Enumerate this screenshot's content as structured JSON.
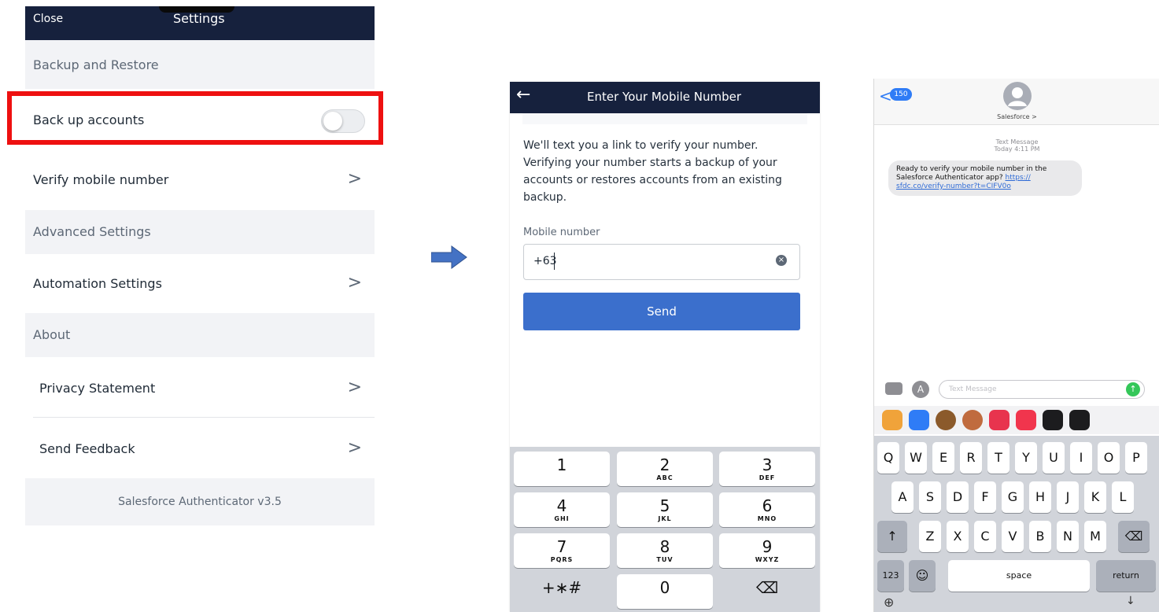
{
  "settings_panel": {
    "close": "Close",
    "title": "Settings",
    "section_backup": "Backup and Restore",
    "backup_label": "Back up accounts",
    "backup_enabled": false,
    "verify_label": "Verify mobile number",
    "section_advanced": "Advanced Settings",
    "automation_label": "Automation Settings",
    "section_about": "About",
    "privacy_label": "Privacy Statement",
    "feedback_label": "Send Feedback",
    "version": "Salesforce Authenticator v3.5",
    "chevron": ">",
    "highlight_color": "#ee1010"
  },
  "mobile_panel": {
    "back_icon": "←",
    "title": "Enter Your Mobile Number",
    "body": "We'll text you a link to verify your number. Verifying your number starts a backup of your accounts or restores accounts from an existing backup.",
    "field_label": "Mobile number",
    "field_value": "+63",
    "clear_icon": "×",
    "send_label": "Send",
    "accent_color": "#3b6fcc",
    "keypad": [
      {
        "n": "1",
        "l": ""
      },
      {
        "n": "2",
        "l": "ABC"
      },
      {
        "n": "3",
        "l": "DEF"
      },
      {
        "n": "4",
        "l": "GHI"
      },
      {
        "n": "5",
        "l": "JKL"
      },
      {
        "n": "6",
        "l": "MNO"
      },
      {
        "n": "7",
        "l": "PQRS"
      },
      {
        "n": "8",
        "l": "TUV"
      },
      {
        "n": "9",
        "l": "WXYZ"
      },
      {
        "n": "+∗#",
        "l": ""
      },
      {
        "n": "0",
        "l": ""
      },
      {
        "n": "⌫",
        "l": ""
      }
    ]
  },
  "messages_panel": {
    "badge": "150",
    "sender": "Salesforce >",
    "timestamp_type": "Text Message",
    "timestamp": "Today 4:11 PM",
    "message_text": "Ready to verify your mobile number in the Salesforce Authenticator app? ",
    "message_link": "https://\nsfdc.co/verify-number?t=CIFV0o",
    "input_placeholder": "Text Message",
    "keyboard_row1": [
      "Q",
      "W",
      "E",
      "R",
      "T",
      "Y",
      "U",
      "I",
      "O",
      "P"
    ],
    "keyboard_row2": [
      "A",
      "S",
      "D",
      "F",
      "G",
      "H",
      "J",
      "K",
      "L"
    ],
    "keyboard_row3": [
      "Z",
      "X",
      "C",
      "V",
      "B",
      "N",
      "M"
    ],
    "shift_icon": "↑",
    "delete_icon": "⌫",
    "numbers_key": "123",
    "emoji_icon": "☺",
    "space_key": "space",
    "return_key": "return",
    "globe_icon": "⊕",
    "mic_icon": "↓"
  }
}
